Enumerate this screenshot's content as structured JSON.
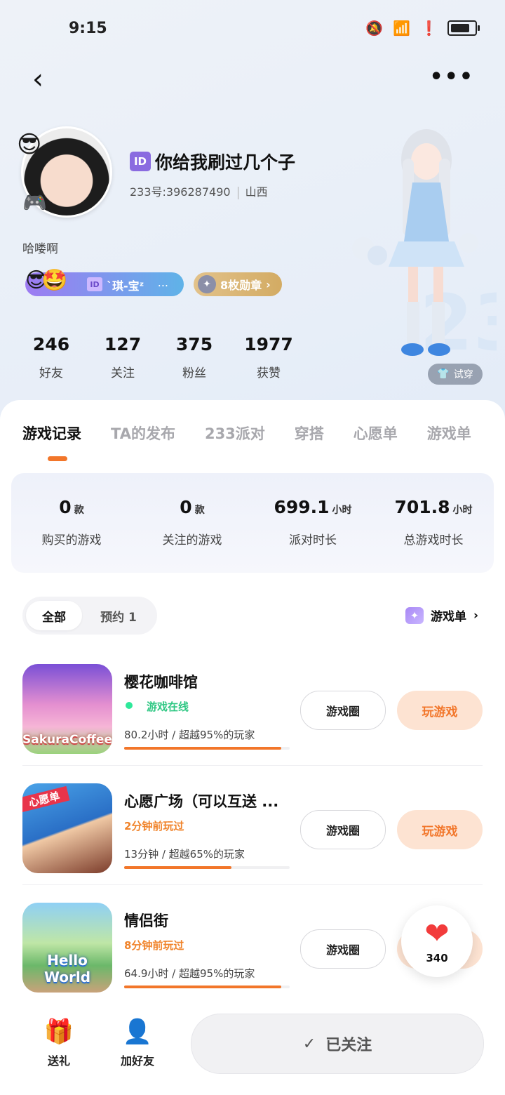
{
  "status_bar": {
    "time": "9:15"
  },
  "profile": {
    "id_badge": "ID",
    "nickname": "你给我刷过几个子",
    "uid": "233号:396287490",
    "location": "山西",
    "bio": "哈喽啊",
    "title_badge": "ID",
    "title_text": "`琪-宝ᶻ",
    "title_ellipsis": "...",
    "medal_text": "8枚勋章",
    "stats": [
      {
        "value": "246",
        "label": "好友"
      },
      {
        "value": "127",
        "label": "关注"
      },
      {
        "value": "375",
        "label": "粉丝"
      },
      {
        "value": "1977",
        "label": "获赞"
      }
    ],
    "try_on": "试穿"
  },
  "tabs": [
    "游戏记录",
    "TA的发布",
    "233派对",
    "穿搭",
    "心愿单",
    "游戏单"
  ],
  "summary": [
    {
      "value": "0",
      "unit": "款",
      "label": "购买的游戏"
    },
    {
      "value": "0",
      "unit": "款",
      "label": "关注的游戏"
    },
    {
      "value": "699.1",
      "unit": "小时",
      "label": "派对时长"
    },
    {
      "value": "701.8",
      "unit": "小时",
      "label": "总游戏时长"
    }
  ],
  "filter": {
    "all": "全部",
    "reserved": "预约 1"
  },
  "game_list_link": "游戏单",
  "games": [
    {
      "name": "樱花咖啡馆",
      "status": "游戏在线",
      "status_type": "online",
      "meta": "80.2小时  /  超越95%的玩家",
      "progress": 0.95,
      "icon_label": "SakuraCoffee"
    },
    {
      "name": "心愿广场（可以互送 ...",
      "status": "2分钟前玩过",
      "status_type": "recent",
      "meta": "13分钟  /  超越65%的玩家",
      "progress": 0.65,
      "icon_label": "心愿单"
    },
    {
      "name": "情侣街",
      "status": "8分钟前玩过",
      "status_type": "recent",
      "meta": "64.9小时  /  超越95%的玩家",
      "progress": 0.95,
      "icon_label": "Hello World"
    }
  ],
  "game_buttons": {
    "circle": "游戏圈",
    "play": "玩游戏"
  },
  "like_count": "340",
  "bottom": {
    "gift": "送礼",
    "add_friend": "加好友",
    "followed": "已关注"
  },
  "colors": {
    "accent": "#f2762a",
    "online": "#2ec783",
    "like": "#f23b3b",
    "title_pill_start": "#9e7bf2",
    "title_pill_end": "#5fb3e8",
    "medal_pill": "#d3ab63"
  }
}
